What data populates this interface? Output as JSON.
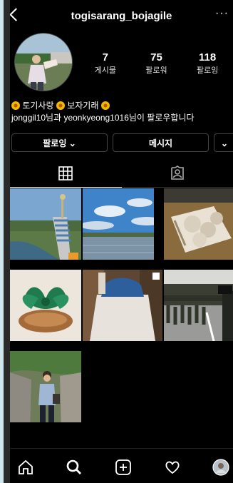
{
  "header": {
    "username": "togisarang_bojagile",
    "back_icon": "chevron-left-icon",
    "more_icon": "more-icon",
    "more_glyph": "···"
  },
  "profile": {
    "stats": [
      {
        "value": "7",
        "label": "게시물"
      },
      {
        "value": "75",
        "label": "팔로워"
      },
      {
        "value": "118",
        "label": "팔로잉"
      }
    ],
    "bio_line1_parts": [
      "토기사랑",
      "보자기래"
    ],
    "bio_line2": "jonggil10님과 yeonkyeong1016님이 팔로우합니다"
  },
  "buttons": {
    "following": "팔로잉 ⌄",
    "message": "메시지",
    "dropdown": "⌄"
  },
  "tabs": [
    {
      "icon": "grid-icon",
      "active": true
    },
    {
      "icon": "tagged-icon",
      "active": false
    }
  ],
  "posts": [
    {
      "icon": "photo-statue-stairs"
    },
    {
      "icon": "photo-lake-sky"
    },
    {
      "icon": "photo-fabric-flowers"
    },
    {
      "icon": "photo-green-bojagi"
    },
    {
      "icon": "photo-blue-bundle"
    },
    {
      "icon": "photo-soldiers-march"
    },
    {
      "icon": "photo-woman-rockwall"
    }
  ],
  "nav": [
    {
      "icon": "home-icon"
    },
    {
      "icon": "search-icon"
    },
    {
      "icon": "add-post-icon"
    },
    {
      "icon": "heart-icon"
    },
    {
      "icon": "profile-avatar-icon"
    }
  ],
  "colors": {
    "background": "#000000",
    "text": "#ffffff",
    "border": "#444444",
    "flower": "#f5b800"
  }
}
